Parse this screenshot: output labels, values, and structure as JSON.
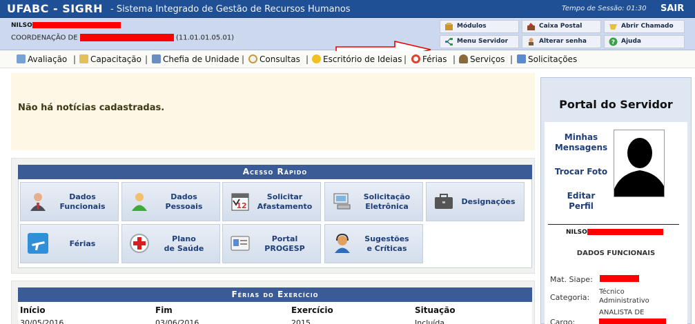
{
  "header": {
    "app_name": "UFABC - SIGRH",
    "subtitle": "- Sistema Integrado de Gestão de Recursos Humanos",
    "session_label": "Tempo de Sessão: 01:30",
    "logout": "SAIR"
  },
  "user": {
    "name": "NILSO",
    "coordination_prefix": "COORDENAÇÃO DE",
    "coordination_code": "(11.01.01.05.01)",
    "redaction_color": "#ff0000"
  },
  "shortcuts": [
    {
      "label": "Módulos",
      "icon": "modules-icon"
    },
    {
      "label": "Caixa Postal",
      "icon": "mailbox-icon"
    },
    {
      "label": "Abrir Chamado",
      "icon": "ticket-icon"
    },
    {
      "label": "Menu Servidor",
      "icon": "menu-tree-icon"
    },
    {
      "label": "Alterar senha",
      "icon": "password-user-icon"
    },
    {
      "label": "Ajuda",
      "icon": "help-icon"
    }
  ],
  "menu": [
    {
      "label": "Avaliação",
      "icon": "pencil-icon"
    },
    {
      "label": "Capacitação",
      "icon": "notepad-icon"
    },
    {
      "label": "Chefia de Unidade",
      "icon": "org-chart-icon"
    },
    {
      "label": "Consultas",
      "icon": "magnifier-icon"
    },
    {
      "label": "Escritório de Ideias",
      "icon": "lightbulb-icon"
    },
    {
      "label": "Férias",
      "icon": "lifebuoy-icon"
    },
    {
      "label": "Serviços",
      "icon": "person-icon"
    },
    {
      "label": "Solicitações",
      "icon": "document-icon"
    }
  ],
  "news": {
    "message": "Não há notícias cadastradas."
  },
  "quick_access": {
    "title": "Acesso Rápido",
    "tiles": [
      {
        "label": "Dados\nFuncionais",
        "icon": "employee-icon"
      },
      {
        "label": "Dados\nPessoais",
        "icon": "person-green-icon"
      },
      {
        "label": "Solicitar\nAfastamento",
        "icon": "calendar-icon"
      },
      {
        "label": "Solicitação\nEletrônica",
        "icon": "computer-icon"
      },
      {
        "label": "Designações",
        "icon": "briefcase-icon"
      },
      {
        "label": "Férias",
        "icon": "airplane-icon"
      },
      {
        "label": "Plano\nde Saúde",
        "icon": "health-cross-icon"
      },
      {
        "label": "Portal\nPROGESP",
        "icon": "id-card-icon"
      },
      {
        "label": "Sugestões\ne Críticas",
        "icon": "headset-icon"
      }
    ]
  },
  "vacation": {
    "title": "Férias do Exercício",
    "columns": [
      "Início",
      "Fim",
      "Exercício",
      "Situação"
    ],
    "rows": [
      [
        "30/05/2016",
        "03/06/2016",
        "2015",
        "Incluída"
      ]
    ]
  },
  "portal": {
    "title": "Portal do Servidor",
    "links": [
      "Minhas\nMensagens",
      "Trocar Foto",
      "Editar Perfil"
    ],
    "user_name": "NILSO",
    "section": "DADOS FUNCIONAIS",
    "fields": [
      {
        "key": "Mat. Siape:",
        "value": ""
      },
      {
        "key": "Categoria:",
        "value": "Técnico\nAdministrativo"
      },
      {
        "key": "Cargo:",
        "value": "ANALISTA DE"
      }
    ]
  }
}
